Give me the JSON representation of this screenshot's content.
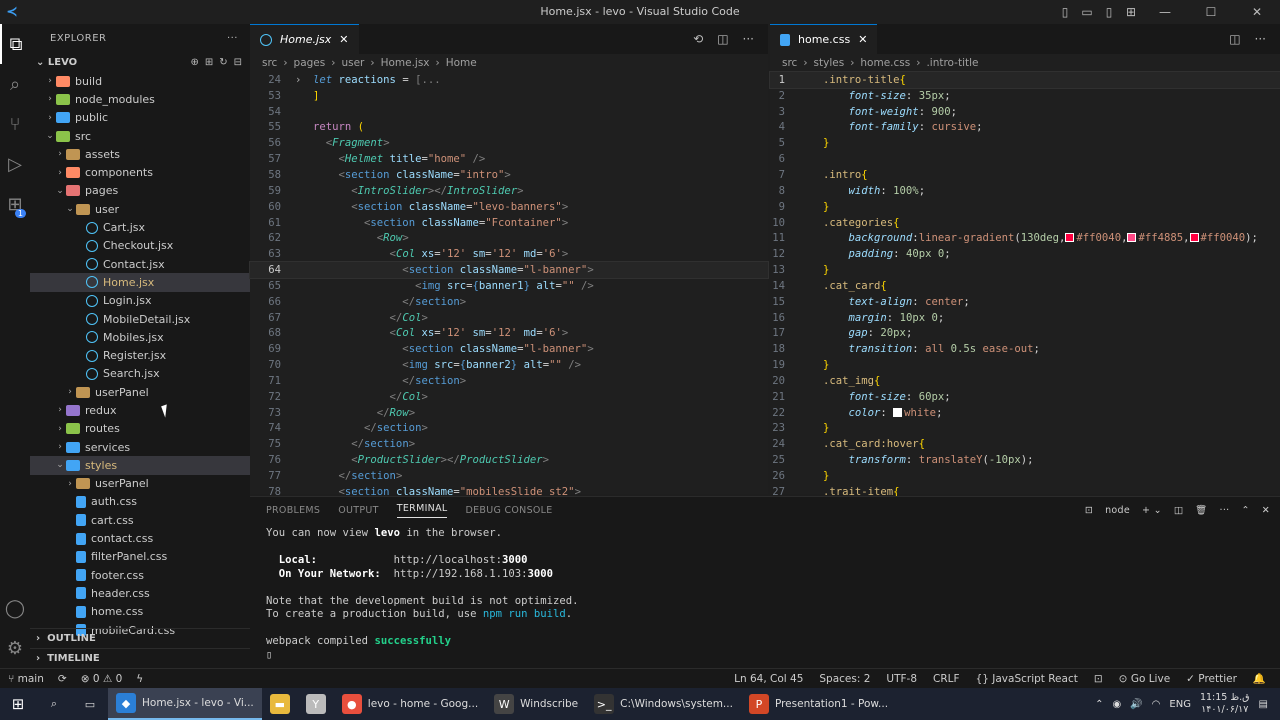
{
  "window": {
    "title": "Home.jsx - levo - Visual Studio Code"
  },
  "explorer": {
    "header": "EXPLORER",
    "project": "LEVO",
    "tree": [
      {
        "label": "build",
        "depth": 1,
        "type": "folder",
        "color": "folder-o",
        "open": false
      },
      {
        "label": "node_modules",
        "depth": 1,
        "type": "folder",
        "color": "folder-g",
        "open": false
      },
      {
        "label": "public",
        "depth": 1,
        "type": "folder",
        "color": "folder-b",
        "open": false
      },
      {
        "label": "src",
        "depth": 1,
        "type": "folder",
        "color": "folder-g",
        "open": true
      },
      {
        "label": "assets",
        "depth": 2,
        "type": "folder",
        "color": "folder",
        "open": false
      },
      {
        "label": "components",
        "depth": 2,
        "type": "folder",
        "color": "folder-o",
        "open": false
      },
      {
        "label": "pages",
        "depth": 2,
        "type": "folder",
        "color": "folder-r",
        "open": true
      },
      {
        "label": "user",
        "depth": 3,
        "type": "folder",
        "color": "folder",
        "open": true
      },
      {
        "label": "Cart.jsx",
        "depth": 4,
        "type": "react"
      },
      {
        "label": "Checkout.jsx",
        "depth": 4,
        "type": "react"
      },
      {
        "label": "Contact.jsx",
        "depth": 4,
        "type": "react"
      },
      {
        "label": "Home.jsx",
        "depth": 4,
        "type": "react",
        "selected": true
      },
      {
        "label": "Login.jsx",
        "depth": 4,
        "type": "react"
      },
      {
        "label": "MobileDetail.jsx",
        "depth": 4,
        "type": "react"
      },
      {
        "label": "Mobiles.jsx",
        "depth": 4,
        "type": "react"
      },
      {
        "label": "Register.jsx",
        "depth": 4,
        "type": "react"
      },
      {
        "label": "Search.jsx",
        "depth": 4,
        "type": "react"
      },
      {
        "label": "userPanel",
        "depth": 3,
        "type": "folder",
        "color": "folder",
        "open": false
      },
      {
        "label": "redux",
        "depth": 2,
        "type": "folder",
        "color": "folder-p",
        "open": false
      },
      {
        "label": "routes",
        "depth": 2,
        "type": "folder",
        "color": "folder-g",
        "open": false
      },
      {
        "label": "services",
        "depth": 2,
        "type": "folder",
        "color": "folder-b",
        "open": false
      },
      {
        "label": "styles",
        "depth": 2,
        "type": "folder",
        "color": "folder-b",
        "open": true,
        "selected": true
      },
      {
        "label": "userPanel",
        "depth": 3,
        "type": "folder",
        "color": "folder",
        "open": false
      },
      {
        "label": "auth.css",
        "depth": 3,
        "type": "css"
      },
      {
        "label": "cart.css",
        "depth": 3,
        "type": "css"
      },
      {
        "label": "contact.css",
        "depth": 3,
        "type": "css"
      },
      {
        "label": "filterPanel.css",
        "depth": 3,
        "type": "css"
      },
      {
        "label": "footer.css",
        "depth": 3,
        "type": "css"
      },
      {
        "label": "header.css",
        "depth": 3,
        "type": "css"
      },
      {
        "label": "home.css",
        "depth": 3,
        "type": "css"
      },
      {
        "label": "mobileCard.css",
        "depth": 3,
        "type": "css"
      }
    ],
    "outline": "OUTLINE",
    "timeline": "TIMELINE"
  },
  "editor_left": {
    "tab": "Home.jsx",
    "breadcrumb": [
      "src",
      "pages",
      "user",
      "Home.jsx",
      "Home"
    ],
    "lines": [
      {
        "n": "24",
        "html": "<span class='b it'>let</span> <span class='a'>reactions</span> = <span class='p'>[...</span>",
        "fold": true
      },
      {
        "n": "53",
        "html": "<span class='y'>]</span>"
      },
      {
        "n": "54",
        "html": ""
      },
      {
        "n": "55",
        "html": "<span class='k'>return</span> <span class='y'>(</span>"
      },
      {
        "n": "56",
        "html": "  <span class='p'>&lt;</span><span class='t it'>Fragment</span><span class='p'>&gt;</span>"
      },
      {
        "n": "57",
        "html": "    <span class='p'>&lt;</span><span class='t it'>Helmet</span> <span class='a'>title</span>=<span class='s'>\"home\"</span> <span class='p'>/&gt;</span>"
      },
      {
        "n": "58",
        "html": "    <span class='p'>&lt;</span><span class='b'>section</span> <span class='a'>className</span>=<span class='s'>\"intro\"</span><span class='p'>&gt;</span>"
      },
      {
        "n": "59",
        "html": "      <span class='p'>&lt;</span><span class='t it'>IntroSlider</span><span class='p'>&gt;&lt;/</span><span class='t it'>IntroSlider</span><span class='p'>&gt;</span>"
      },
      {
        "n": "60",
        "html": "      <span class='p'>&lt;</span><span class='b'>section</span> <span class='a'>className</span>=<span class='s'>\"levo-banners\"</span><span class='p'>&gt;</span>"
      },
      {
        "n": "61",
        "html": "        <span class='p'>&lt;</span><span class='b'>section</span> <span class='a'>className</span>=<span class='s'>\"Fcontainer\"</span><span class='p'>&gt;</span>"
      },
      {
        "n": "62",
        "html": "          <span class='p'>&lt;</span><span class='t it'>Row</span><span class='p'>&gt;</span>"
      },
      {
        "n": "63",
        "html": "            <span class='p'>&lt;</span><span class='t it'>Col</span> <span class='a'>xs</span>=<span class='s'>'12'</span> <span class='a'>sm</span>=<span class='s'>'12'</span> <span class='a'>md</span>=<span class='s'>'6'</span><span class='p'>&gt;</span>"
      },
      {
        "n": "64",
        "html": "              <span class='p'>&lt;</span><span class='b'>section</span> <span class='a'>className</span>=<span class='s'>\"l-banner\"</span><span class='p'>&gt;</span>",
        "current": true
      },
      {
        "n": "65",
        "html": "                <span class='p'>&lt;</span><span class='b'>img</span> <span class='a'>src</span>=<span class='b'>{</span><span class='a'>banner1</span><span class='b'>}</span> <span class='a'>alt</span>=<span class='s'>\"\"</span> <span class='p'>/&gt;</span>"
      },
      {
        "n": "66",
        "html": "              <span class='p'>&lt;/</span><span class='b'>section</span><span class='p'>&gt;</span>"
      },
      {
        "n": "67",
        "html": "            <span class='p'>&lt;/</span><span class='t it'>Col</span><span class='p'>&gt;</span>"
      },
      {
        "n": "68",
        "html": "            <span class='p'>&lt;</span><span class='t it'>Col</span> <span class='a'>xs</span>=<span class='s'>'12'</span> <span class='a'>sm</span>=<span class='s'>'12'</span> <span class='a'>md</span>=<span class='s'>'6'</span><span class='p'>&gt;</span>"
      },
      {
        "n": "69",
        "html": "              <span class='p'>&lt;</span><span class='b'>section</span> <span class='a'>className</span>=<span class='s'>\"l-banner\"</span><span class='p'>&gt;</span>"
      },
      {
        "n": "70",
        "html": "              <span class='p'>&lt;</span><span class='b'>img</span> <span class='a'>src</span>=<span class='b'>{</span><span class='a'>banner2</span><span class='b'>}</span> <span class='a'>alt</span>=<span class='s'>\"\"</span> <span class='p'>/&gt;</span>"
      },
      {
        "n": "71",
        "html": "              <span class='p'>&lt;/</span><span class='b'>section</span><span class='p'>&gt;</span>"
      },
      {
        "n": "72",
        "html": "            <span class='p'>&lt;/</span><span class='t it'>Col</span><span class='p'>&gt;</span>"
      },
      {
        "n": "73",
        "html": "          <span class='p'>&lt;/</span><span class='t it'>Row</span><span class='p'>&gt;</span>"
      },
      {
        "n": "74",
        "html": "        <span class='p'>&lt;/</span><span class='b'>section</span><span class='p'>&gt;</span>"
      },
      {
        "n": "75",
        "html": "      <span class='p'>&lt;/</span><span class='b'>section</span><span class='p'>&gt;</span>"
      },
      {
        "n": "76",
        "html": "      <span class='p'>&lt;</span><span class='t it'>ProductSlider</span><span class='p'>&gt;&lt;/</span><span class='t it'>ProductSlider</span><span class='p'>&gt;</span>"
      },
      {
        "n": "77",
        "html": "    <span class='p'>&lt;/</span><span class='b'>section</span><span class='p'>&gt;</span>"
      },
      {
        "n": "78",
        "html": "    <span class='p'>&lt;</span><span class='b'>section</span> <span class='a'>className</span>=<span class='s'>\"mobilesSlide st2\"</span><span class='p'>&gt;</span>"
      }
    ]
  },
  "editor_right": {
    "tab": "home.css",
    "breadcrumb": [
      "src",
      "styles",
      "home.css",
      ".intro-title"
    ],
    "lines": [
      {
        "n": "1",
        "html": "<span class='sel'>.intro-title</span><span class='y'>{</span>",
        "current": true
      },
      {
        "n": "2",
        "html": "    <span class='prop it'>font-size</span>: <span class='n'>35px</span>;"
      },
      {
        "n": "3",
        "html": "    <span class='prop it'>font-weight</span>: <span class='n'>900</span>;"
      },
      {
        "n": "4",
        "html": "    <span class='prop it'>font-family</span>: <span class='val'>cursive</span>;"
      },
      {
        "n": "5",
        "html": "<span class='y'>}</span>"
      },
      {
        "n": "6",
        "html": ""
      },
      {
        "n": "7",
        "html": "<span class='sel'>.intro</span><span class='y'>{</span>"
      },
      {
        "n": "8",
        "html": "    <span class='prop it'>width</span>: <span class='n'>100%</span>;"
      },
      {
        "n": "9",
        "html": "<span class='y'>}</span>"
      },
      {
        "n": "10",
        "html": "<span class='sel'>.categories</span><span class='y'>{</span>"
      },
      {
        "n": "11",
        "html": "    <span class='prop it'>background</span>:<span class='val'>linear-gradient</span>(<span class='n'>130deg</span>,<span class='sw' style='background:#ff0040'></span><span class='val'>#ff0040</span>,<span class='sw' style='background:#ff4885'></span><span class='val'>#ff4885</span>,<span class='sw' style='background:#ff0040'></span><span class='val'>#ff0040</span>);"
      },
      {
        "n": "12",
        "html": "    <span class='prop it'>padding</span>: <span class='n'>40px 0</span>;"
      },
      {
        "n": "13",
        "html": "<span class='y'>}</span>"
      },
      {
        "n": "14",
        "html": "<span class='sel'>.cat_card</span><span class='y'>{</span>"
      },
      {
        "n": "15",
        "html": "    <span class='prop it'>text-align</span>: <span class='val'>center</span>;"
      },
      {
        "n": "16",
        "html": "    <span class='prop it'>margin</span>: <span class='n'>10px 0</span>;"
      },
      {
        "n": "17",
        "html": "    <span class='prop it'>gap</span>: <span class='n'>20px</span>;"
      },
      {
        "n": "18",
        "html": "    <span class='prop it'>transition</span>: <span class='val'>all</span> <span class='n'>0.5s</span> <span class='val'>ease-out</span>;"
      },
      {
        "n": "19",
        "html": "<span class='y'>}</span>"
      },
      {
        "n": "20",
        "html": "<span class='sel'>.cat_img</span><span class='y'>{</span>"
      },
      {
        "n": "21",
        "html": "    <span class='prop it'>font-size</span>: <span class='n'>60px</span>;"
      },
      {
        "n": "22",
        "html": "    <span class='prop it'>color</span>: <span class='sw' style='background:#fff'></span><span class='val'>white</span>;"
      },
      {
        "n": "23",
        "html": "<span class='y'>}</span>"
      },
      {
        "n": "24",
        "html": "<span class='sel'>.cat_card:hover</span><span class='y'>{</span>"
      },
      {
        "n": "25",
        "html": "    <span class='prop it'>transform</span>: <span class='val'>translateY</span>(<span class='n'>-10px</span>);"
      },
      {
        "n": "26",
        "html": "<span class='y'>}</span>"
      },
      {
        "n": "27",
        "html": "<span class='sel'>.trait-item</span><span class='y'>{</span>"
      }
    ]
  },
  "panel": {
    "tabs": [
      "PROBLEMS",
      "OUTPUT",
      "TERMINAL",
      "DEBUG CONSOLE"
    ],
    "active_tab": "TERMINAL",
    "shell": "node",
    "terminal_html": "You can now view <span class='bold'>levo</span> in the browser.\n\n  <span class='bold'>Local:</span>            http://localhost:<span class='bold'>3000</span>\n  <span class='bold'>On Your Network:</span>  http://192.168.1.103:<span class='bold'>3000</span>\n\nNote that the development build is not optimized.\nTo create a production build, use <span class='cyan'>npm run build</span>.\n\nwebpack compiled <span class='g'>successfully</span>\n▯"
  },
  "status": {
    "branch": "main",
    "errors": "⊗ 0 ⚠ 0",
    "position": "Ln 64, Col 45",
    "spaces": "Spaces: 2",
    "encoding": "UTF-8",
    "eol": "CRLF",
    "language": "JavaScript React",
    "golive": "Go Live",
    "prettier": "Prettier"
  },
  "taskbar": {
    "apps": [
      {
        "label": "Home.jsx - levo - Vi...",
        "color": "#2b7fd6",
        "glyph": "◆",
        "active": true
      },
      {
        "label": "",
        "color": "#e8b93d",
        "glyph": "▬"
      },
      {
        "label": "",
        "color": "#bbbbbb",
        "glyph": "Y"
      },
      {
        "label": "levo - home - Goog...",
        "color": "#e84f3d",
        "glyph": "●"
      },
      {
        "label": "Windscribe",
        "color": "#444",
        "glyph": "W"
      },
      {
        "label": "C:\\Windows\\system...",
        "color": "#333",
        "glyph": ">_"
      },
      {
        "label": "Presentation1 - Pow...",
        "color": "#d24726",
        "glyph": "P"
      }
    ],
    "lang": "ENG",
    "time": "11:15 ق.ظ",
    "date": "۱۴۰۱/۰۶/۱۷"
  }
}
